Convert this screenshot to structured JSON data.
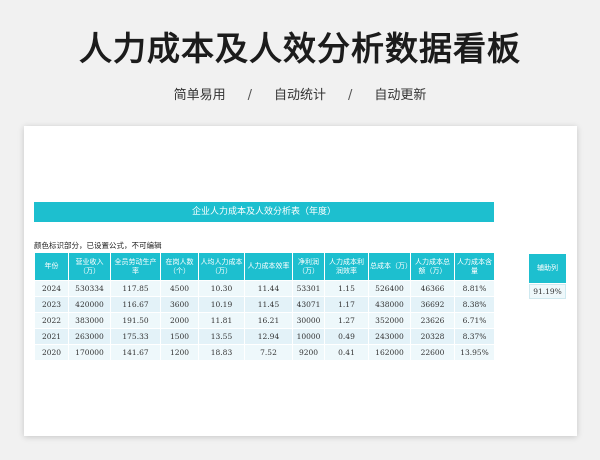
{
  "hero": {
    "title": "人力成本及人效分析数据看板",
    "tags": [
      "简单易用",
      "自动统计",
      "自动更新"
    ],
    "separator": "/"
  },
  "sheet": {
    "banner": "企业人力成本及人效分析表（年度）",
    "note": "颜色标识部分，已设置公式，不可编辑",
    "columns": [
      "年份",
      "营业收入（万）",
      "全员劳动生产率",
      "在岗人数（个）",
      "人均人力成本（万）",
      "人力成本效率",
      "净利润（万）",
      "人力成本利润效率",
      "总成本（万）",
      "人力成本总额（万）",
      "人力成本含量"
    ],
    "rows": [
      [
        "2024",
        "530334",
        "117.85",
        "4500",
        "10.30",
        "11.44",
        "53301",
        "1.15",
        "526400",
        "46366",
        "8.81%"
      ],
      [
        "2023",
        "420000",
        "116.67",
        "3600",
        "10.19",
        "11.45",
        "43071",
        "1.17",
        "438000",
        "36692",
        "8.38%"
      ],
      [
        "2022",
        "383000",
        "191.50",
        "2000",
        "11.81",
        "16.21",
        "30000",
        "1.27",
        "352000",
        "23626",
        "6.71%"
      ],
      [
        "2021",
        "263000",
        "175.33",
        "1500",
        "13.55",
        "12.94",
        "10000",
        "0.49",
        "243000",
        "20328",
        "8.37%"
      ],
      [
        "2020",
        "170000",
        "141.67",
        "1200",
        "18.83",
        "7.52",
        "9200",
        "0.41",
        "162000",
        "22600",
        "13.95%"
      ]
    ],
    "side": {
      "header": "辅助列",
      "value": "91.19%"
    }
  },
  "colors": {
    "accent": "#1dbfcf",
    "row_light": "#eef8fb",
    "row_alt": "#e3f2f8"
  }
}
